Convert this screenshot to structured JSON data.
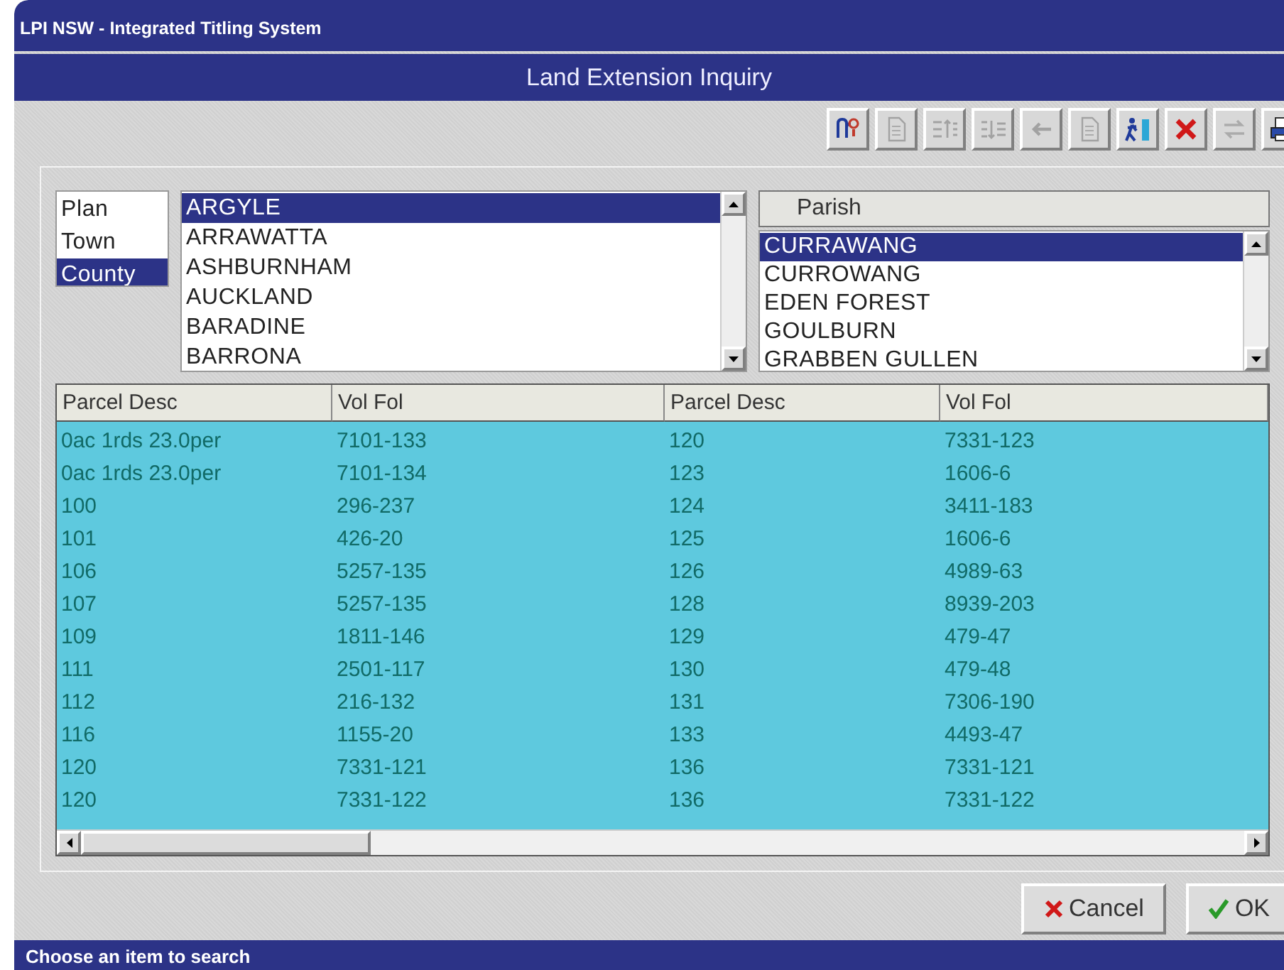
{
  "window": {
    "title": "LPI NSW - Integrated Titling System"
  },
  "header": {
    "title": "Land Extension Inquiry"
  },
  "toolbar": [
    {
      "kind": "help",
      "disabled": false
    },
    {
      "kind": "document",
      "disabled": true
    },
    {
      "kind": "list-left",
      "disabled": true
    },
    {
      "kind": "list-right",
      "disabled": true
    },
    {
      "kind": "arrow-left",
      "disabled": true
    },
    {
      "kind": "document",
      "disabled": true
    },
    {
      "kind": "exit",
      "disabled": false
    },
    {
      "kind": "delete",
      "disabled": false
    },
    {
      "kind": "swap",
      "disabled": true
    },
    {
      "kind": "print",
      "disabled": false
    }
  ],
  "search_type": {
    "items": [
      {
        "label": "Plan",
        "selected": false
      },
      {
        "label": "Town",
        "selected": false
      },
      {
        "label": "County",
        "selected": true
      }
    ]
  },
  "county_list": {
    "items": [
      {
        "label": "ARGYLE",
        "selected": true
      },
      {
        "label": "ARRAWATTA",
        "selected": false
      },
      {
        "label": "ASHBURNHAM",
        "selected": false
      },
      {
        "label": "AUCKLAND",
        "selected": false
      },
      {
        "label": "BARADINE",
        "selected": false
      },
      {
        "label": "BARRONA",
        "selected": false
      }
    ]
  },
  "parish_list": {
    "heading": "Parish",
    "items": [
      {
        "label": "CURRAWANG",
        "selected": true
      },
      {
        "label": "CURROWANG",
        "selected": false
      },
      {
        "label": "EDEN FOREST",
        "selected": false
      },
      {
        "label": "GOULBURN",
        "selected": false
      },
      {
        "label": "GRABBEN GULLEN",
        "selected": false
      }
    ]
  },
  "table": {
    "columns": [
      "Parcel Desc",
      "Vol Fol",
      "Parcel Desc",
      "Vol Fol"
    ],
    "rows": [
      [
        "0ac 1rds 23.0per",
        "7101-133",
        "120",
        "7331-123"
      ],
      [
        "0ac 1rds 23.0per",
        "7101-134",
        "123",
        "1606-6"
      ],
      [
        "100",
        "296-237",
        "124",
        "3411-183"
      ],
      [
        "101",
        "426-20",
        "125",
        "1606-6"
      ],
      [
        "106",
        "5257-135",
        "126",
        "4989-63"
      ],
      [
        "107",
        "5257-135",
        "128",
        "8939-203"
      ],
      [
        "109",
        "1811-146",
        "129",
        "479-47"
      ],
      [
        "111",
        "2501-117",
        "130",
        "479-48"
      ],
      [
        "112",
        "216-132",
        "131",
        "7306-190"
      ],
      [
        "116",
        "1155-20",
        "133",
        "4493-47"
      ],
      [
        "120",
        "7331-121",
        "136",
        "7331-121"
      ],
      [
        "120",
        "7331-122",
        "136",
        "7331-122"
      ]
    ]
  },
  "buttons": [
    {
      "kind": "cancel",
      "label": "Cancel"
    },
    {
      "kind": "ok",
      "label": "OK"
    }
  ],
  "status_bar": {
    "text": "Choose an item to search"
  }
}
